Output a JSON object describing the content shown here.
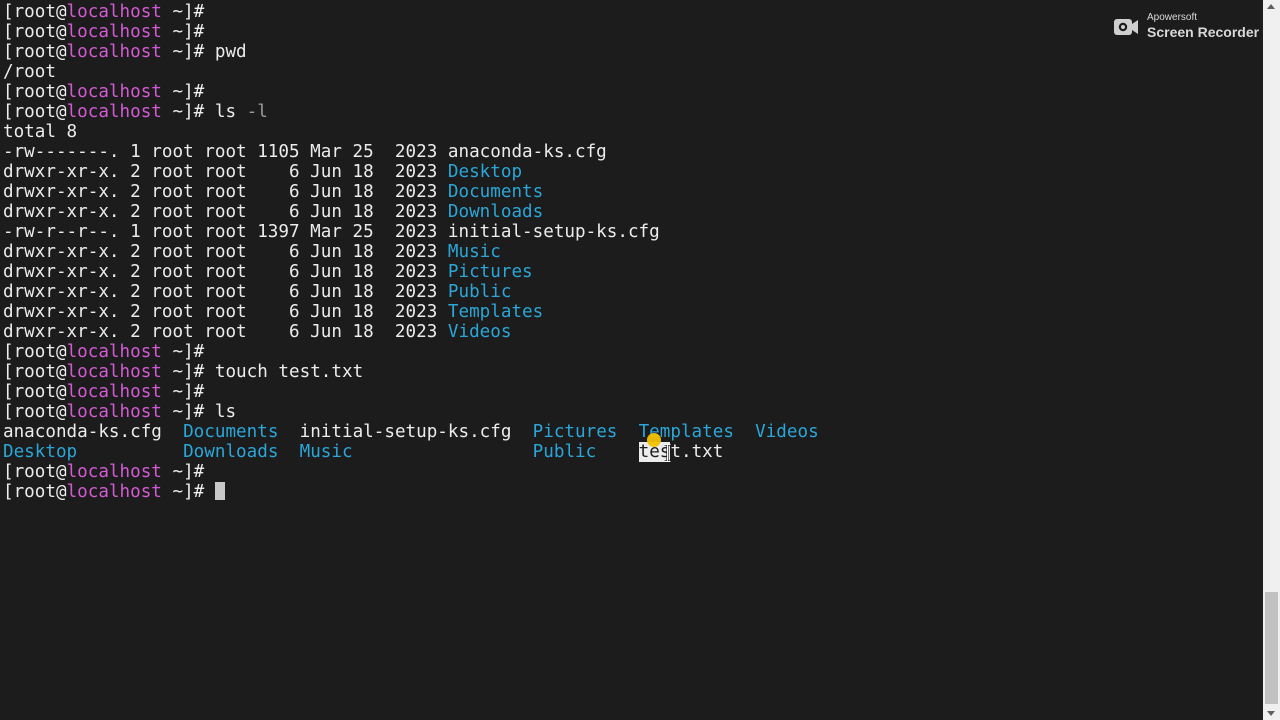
{
  "terminal": {
    "prompt": {
      "user_prefix": "[root@",
      "host": "localhost",
      "path_suffix": " ~]#"
    },
    "commands": {
      "pwd": " pwd",
      "ls_l_cmd": " ls ",
      "ls_l_flag": "-l",
      "touch": " touch test.txt",
      "ls": " ls"
    },
    "pwd_output": "/root",
    "total": "total 8",
    "ls_long": [
      {
        "meta": "-rw-------. 1 root root 1105 Mar 25  2023 ",
        "name": "anaconda-ks.cfg",
        "is_dir": false
      },
      {
        "meta": "drwxr-xr-x. 2 root root    6 Jun 18  2023 ",
        "name": "Desktop",
        "is_dir": true
      },
      {
        "meta": "drwxr-xr-x. 2 root root    6 Jun 18  2023 ",
        "name": "Documents",
        "is_dir": true
      },
      {
        "meta": "drwxr-xr-x. 2 root root    6 Jun 18  2023 ",
        "name": "Downloads",
        "is_dir": true
      },
      {
        "meta": "-rw-r--r--. 1 root root 1397 Mar 25  2023 ",
        "name": "initial-setup-ks.cfg",
        "is_dir": false
      },
      {
        "meta": "drwxr-xr-x. 2 root root    6 Jun 18  2023 ",
        "name": "Music",
        "is_dir": true
      },
      {
        "meta": "drwxr-xr-x. 2 root root    6 Jun 18  2023 ",
        "name": "Pictures",
        "is_dir": true
      },
      {
        "meta": "drwxr-xr-x. 2 root root    6 Jun 18  2023 ",
        "name": "Public",
        "is_dir": true
      },
      {
        "meta": "drwxr-xr-x. 2 root root    6 Jun 18  2023 ",
        "name": "Templates",
        "is_dir": true
      },
      {
        "meta": "drwxr-xr-x. 2 root root    6 Jun 18  2023 ",
        "name": "Videos",
        "is_dir": true
      }
    ],
    "ls_short": {
      "row1": {
        "anaconda": "anaconda-ks.cfg",
        "documents": "Documents",
        "initial_setup": "initial-setup-ks.cfg",
        "pictures": "Pictures",
        "templates": "Templates",
        "videos": "Videos"
      },
      "row2": {
        "desktop": "Desktop",
        "downloads": "Downloads",
        "music": "Music",
        "public": "Public",
        "test_selected": "tes",
        "test_rest": "t.txt"
      }
    }
  },
  "watermark": {
    "brand": "Apowersoft",
    "product": "Screen Recorder"
  },
  "colors": {
    "background": "#1c1c1c",
    "text": "#ececec",
    "hostname": "#d45ad4",
    "directory": "#2aa6d8",
    "mouse_highlight": "#f2c200"
  },
  "icons": [
    "camera-icon",
    "mouse-highlight-icon",
    "text-cursor-icon",
    "scroll-up-icon",
    "scroll-down-icon"
  ]
}
